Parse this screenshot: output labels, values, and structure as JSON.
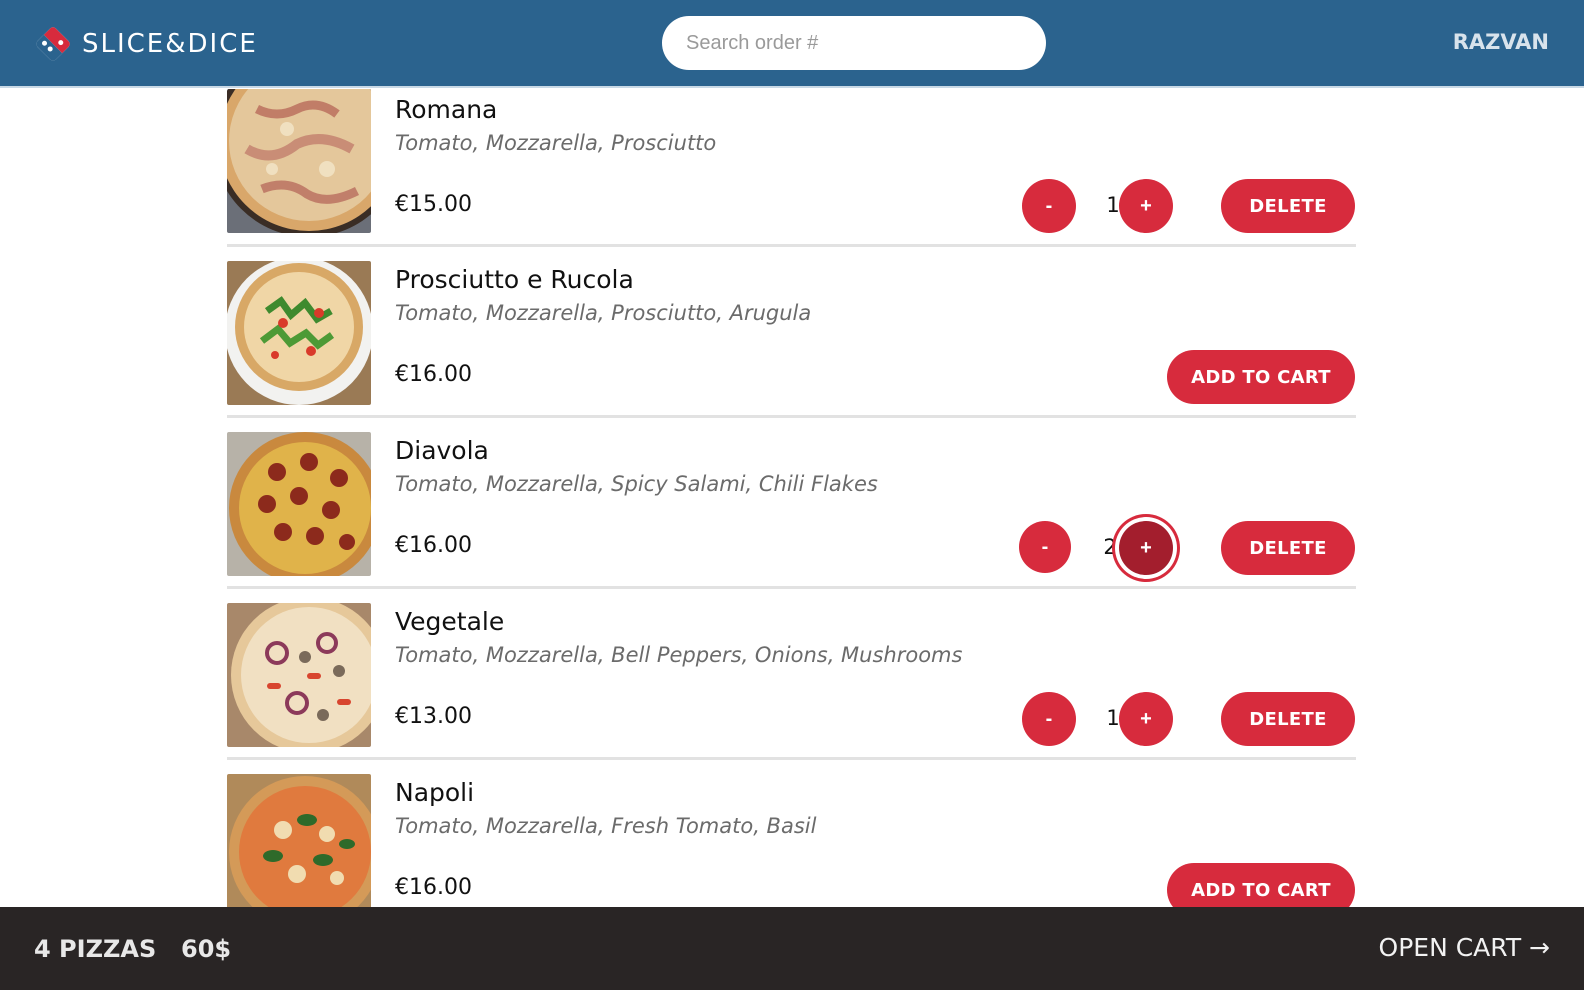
{
  "header": {
    "brand": "SLICE&DICE",
    "search_placeholder": "Search order #",
    "user": "RAZVAN"
  },
  "items": [
    {
      "name": "Romana",
      "ingredients": "Tomato, Mozzarella, Prosciutto",
      "price": "€15.00",
      "in_cart": true,
      "quantity": "1",
      "minus": "-",
      "plus": "+",
      "action": "DELETE"
    },
    {
      "name": "Prosciutto e Rucola",
      "ingredients": "Tomato, Mozzarella, Prosciutto, Arugula",
      "price": "€16.00",
      "in_cart": false,
      "action": "ADD TO CART"
    },
    {
      "name": "Diavola",
      "ingredients": "Tomato, Mozzarella, Spicy Salami, Chili Flakes",
      "price": "€16.00",
      "in_cart": true,
      "quantity": "2",
      "minus": "-",
      "plus": "+",
      "action": "DELETE"
    },
    {
      "name": "Vegetale",
      "ingredients": "Tomato, Mozzarella, Bell Peppers, Onions, Mushrooms",
      "price": "€13.00",
      "in_cart": true,
      "quantity": "1",
      "minus": "-",
      "plus": "+",
      "action": "DELETE"
    },
    {
      "name": "Napoli",
      "ingredients": "Tomato, Mozzarella, Fresh Tomato, Basil",
      "price": "€16.00",
      "in_cart": false,
      "action": "ADD TO CART"
    }
  ],
  "footer": {
    "count": "4 PIZZAS",
    "total": "60$",
    "open_cart": "OPEN CART →"
  },
  "colors": {
    "header_bg": "#2b638e",
    "accent": "#d72b3d",
    "footer_bg": "#292525"
  }
}
